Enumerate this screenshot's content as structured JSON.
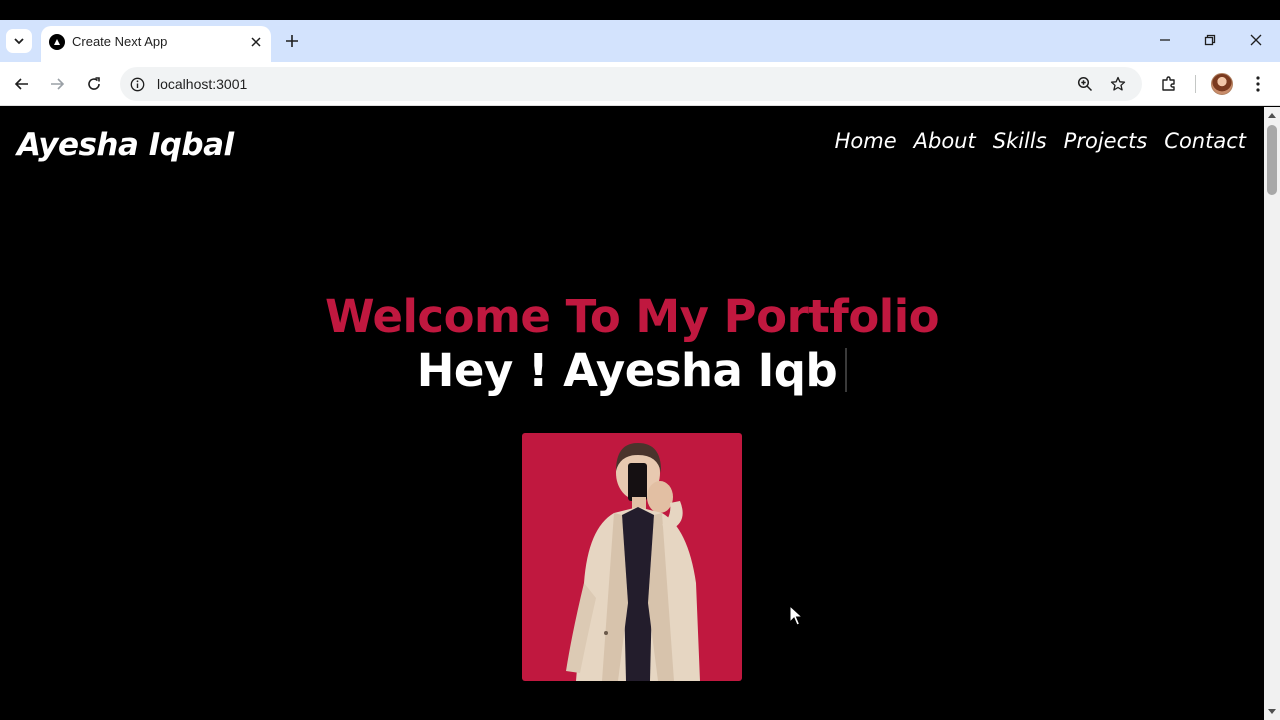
{
  "browser": {
    "tab_title": "Create Next App",
    "url": "localhost:3001",
    "icons": {
      "tab_search": "chevron-down-icon",
      "favicon": "nextjs-logo-icon",
      "tab_close": "close-icon",
      "new_tab": "plus-icon",
      "minimize": "minimize-icon",
      "restore": "restore-icon",
      "close_window": "close-icon",
      "back": "arrow-left-icon",
      "forward": "arrow-right-icon",
      "reload": "reload-icon",
      "site_info": "info-icon",
      "zoom": "zoom-icon",
      "bookmark": "star-icon",
      "extensions": "puzzle-icon",
      "menu": "kebab-menu-icon"
    }
  },
  "site": {
    "brand": "Ayesha Iqbal",
    "nav": [
      "Home",
      "About",
      "Skills",
      "Projects",
      "Contact"
    ],
    "hero": {
      "title": "Welcome To My Portfolio",
      "typed_text": "Hey ! Ayesha Iqb"
    },
    "colors": {
      "background": "#000000",
      "accent": "#c0183f",
      "text": "#ffffff"
    }
  }
}
